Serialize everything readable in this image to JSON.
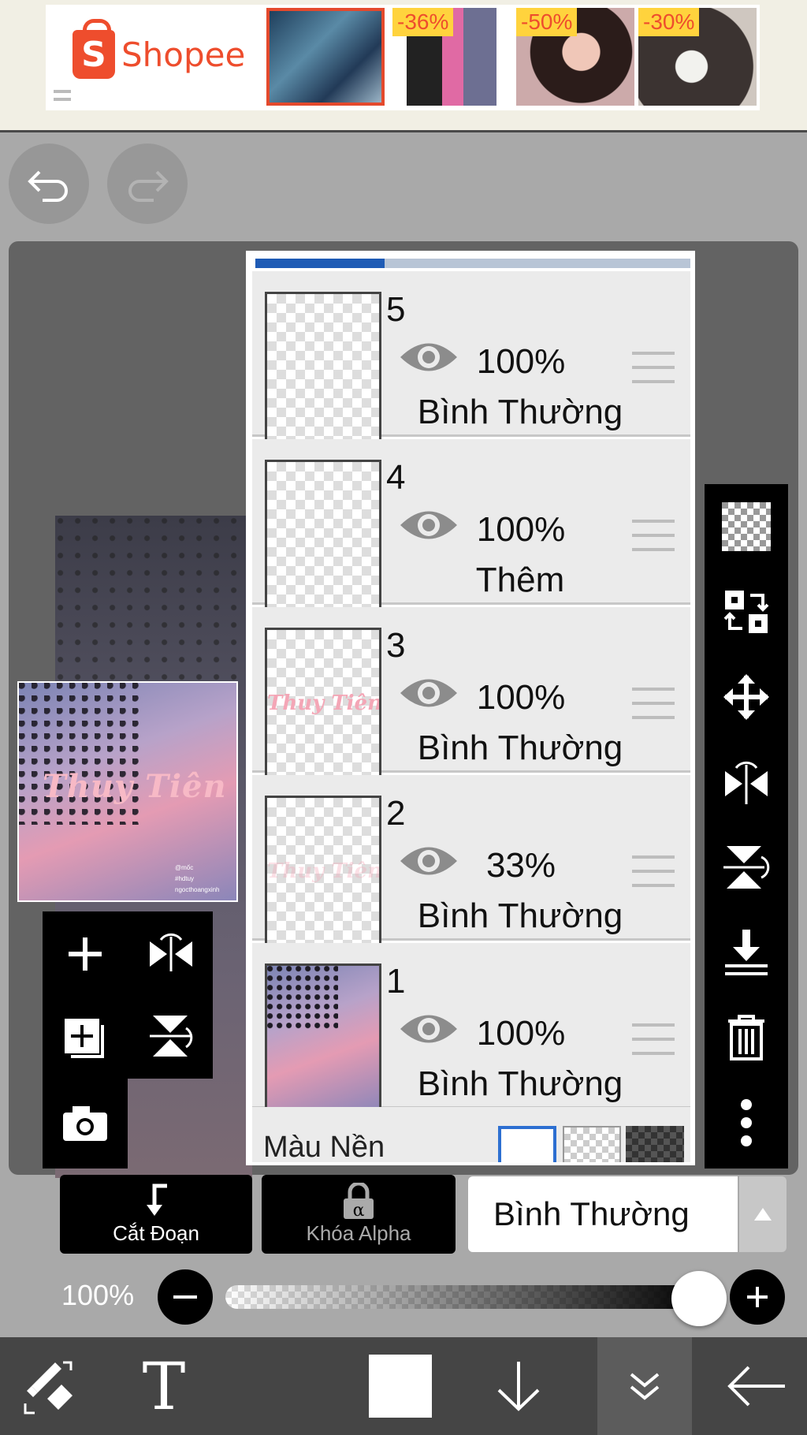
{
  "ad": {
    "brand": "Shopee",
    "products": [
      {
        "badge": ""
      },
      {
        "badge": "-36%"
      },
      {
        "badge": "-50%"
      },
      {
        "badge": "-30%"
      }
    ]
  },
  "history": {
    "undo_icon": "undo-icon",
    "redo_icon": "redo-icon"
  },
  "artwork": {
    "title": "Thuy   Tiên",
    "credits": [
      "@mốc",
      "#hdtuy",
      "ngocthoangxinh"
    ]
  },
  "layers": [
    {
      "number": "5",
      "opacity": "100%",
      "blend": "Bình Thường"
    },
    {
      "number": "4",
      "opacity": "100%",
      "blend": "Thêm"
    },
    {
      "number": "3",
      "opacity": "100%",
      "blend": "Bình Thường",
      "preview_text": "Thuy  Tiên"
    },
    {
      "number": "2",
      "opacity": "33%",
      "blend": "Bình Thường",
      "preview_text": "Thuy  Tiên"
    },
    {
      "number": "1",
      "opacity": "100%",
      "blend": "Bình Thường"
    }
  ],
  "background": {
    "label": "Màu Nền",
    "options": [
      "white",
      "transparent",
      "dark-checker"
    ],
    "selected": "white"
  },
  "controls": {
    "clip_label": "Cắt Đoạn",
    "alpha_lock_label": "Khóa Alpha",
    "blend_mode": "Bình Thường",
    "opacity_label": "100%",
    "opacity_value": 100
  },
  "colors": {
    "accent": "#1e5bb5",
    "brand": "#ee4d2d",
    "panel": "#ebebeb"
  }
}
